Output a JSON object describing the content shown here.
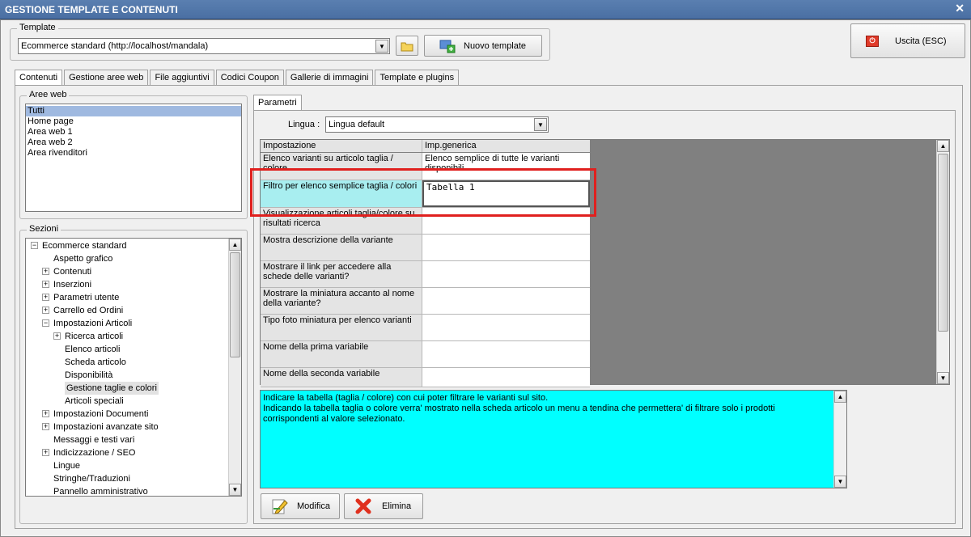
{
  "window": {
    "title": "GESTIONE TEMPLATE E CONTENUTI",
    "close": "✕"
  },
  "template_group": {
    "label": "Template",
    "combo_value": "Ecommerce standard (http://localhost/mandala)",
    "new_template_label": "Nuovo template"
  },
  "exit_button": {
    "label": "Uscita (ESC)"
  },
  "tabs": [
    {
      "label": "Contenuti"
    },
    {
      "label": "Gestione aree web"
    },
    {
      "label": "File aggiuntivi"
    },
    {
      "label": "Codici Coupon"
    },
    {
      "label": "Gallerie di immagini"
    },
    {
      "label": "Template e plugins"
    }
  ],
  "aree_web": {
    "label": "Aree web",
    "items": [
      "Tutti",
      "Home page",
      "Area web 1",
      "Area web 2",
      "Area rivenditori"
    ]
  },
  "sezioni": {
    "label": "Sezioni",
    "nodes": [
      {
        "label": "Ecommerce standard",
        "expander": "−"
      },
      {
        "label": "Aspetto grafico",
        "expander": ""
      },
      {
        "label": "Contenuti",
        "expander": "+"
      },
      {
        "label": "Inserzioni",
        "expander": "+"
      },
      {
        "label": "Parametri utente",
        "expander": "+"
      },
      {
        "label": "Carrello ed Ordini",
        "expander": "+"
      },
      {
        "label": "Impostazioni Articoli",
        "expander": "−"
      },
      {
        "label": "Ricerca articoli",
        "expander": "+"
      },
      {
        "label": "Elenco articoli",
        "expander": ""
      },
      {
        "label": "Scheda articolo",
        "expander": ""
      },
      {
        "label": "Disponibilità",
        "expander": ""
      },
      {
        "label": "Gestione taglie e colori",
        "expander": ""
      },
      {
        "label": "Articoli speciali",
        "expander": ""
      },
      {
        "label": "Impostazioni Documenti",
        "expander": "+"
      },
      {
        "label": "Impostazioni avanzate sito",
        "expander": "+"
      },
      {
        "label": "Messaggi e testi vari",
        "expander": ""
      },
      {
        "label": "Indicizzazione / SEO",
        "expander": "+"
      },
      {
        "label": "Lingue",
        "expander": ""
      },
      {
        "label": "Stringhe/Traduzioni",
        "expander": ""
      },
      {
        "label": "Pannello amministrativo",
        "expander": ""
      }
    ]
  },
  "parametri": {
    "tab_label": "Parametri",
    "lingua_label": "Lingua :",
    "lingua_value": "Lingua default",
    "grid_headers": [
      "Impostazione",
      "Imp.generica"
    ],
    "rows": [
      {
        "setting": "Elenco varianti su articolo taglia / colore",
        "value": "Elenco semplice di tutte le varianti disponibili"
      },
      {
        "setting": "Filtro per elenco semplice taglia / colori",
        "value": "Tabella 1"
      },
      {
        "setting": "Visualizzazione articoli taglia/colore su risultati ricerca",
        "value": ""
      },
      {
        "setting": "Mostra descrizione della variante",
        "value": ""
      },
      {
        "setting": "Mostrare il link per accedere alla schede delle varianti?",
        "value": ""
      },
      {
        "setting": "Mostrare la miniatura accanto al nome della variante?",
        "value": ""
      },
      {
        "setting": "Tipo foto miniatura per elenco varianti",
        "value": ""
      },
      {
        "setting": "Nome della prima variabile",
        "value": ""
      },
      {
        "setting": "Nome della seconda variabile",
        "value": ""
      }
    ],
    "description": "Indicare la tabella (taglia / colore) con cui poter filtrare le varianti sul sito.\nIndicando la tabella taglia o colore verra' mostrato nella scheda articolo un menu a tendina che permettera' di filtrare solo i prodotti corrispondenti al valore selezionato.",
    "modifica_label": "Modifica",
    "elimina_label": "Elimina"
  },
  "colors": {
    "highlight_border": "#e0201e",
    "description_bg": "#00ffff",
    "selected_row_bg": "#a8eef0"
  }
}
